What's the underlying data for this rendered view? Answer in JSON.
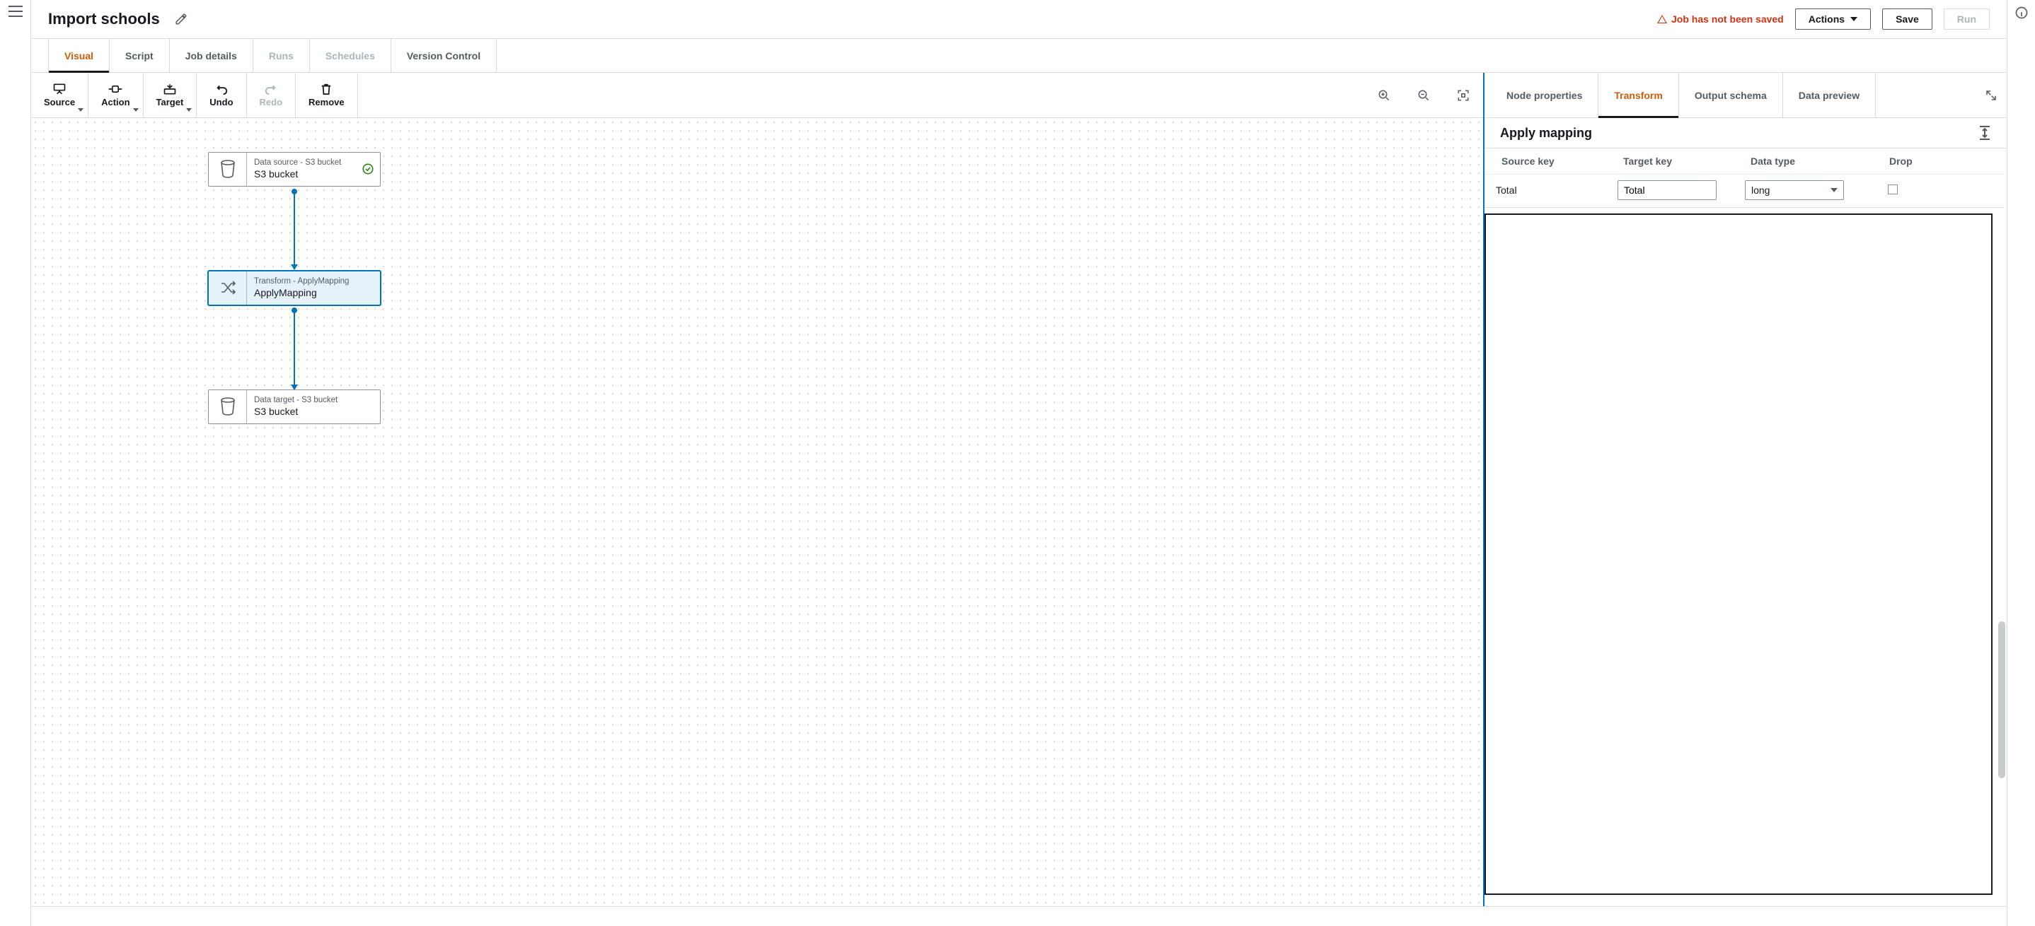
{
  "header": {
    "title": "Import schools",
    "status_text": "Job has not been saved",
    "actions_label": "Actions",
    "save_label": "Save",
    "run_label": "Run"
  },
  "main_tabs": [
    {
      "label": "Visual",
      "active": true,
      "disabled": false
    },
    {
      "label": "Script",
      "active": false,
      "disabled": false
    },
    {
      "label": "Job details",
      "active": false,
      "disabled": false
    },
    {
      "label": "Runs",
      "active": false,
      "disabled": true
    },
    {
      "label": "Schedules",
      "active": false,
      "disabled": true
    },
    {
      "label": "Version Control",
      "active": false,
      "disabled": false
    }
  ],
  "canvas_toolbar": {
    "source": "Source",
    "action": "Action",
    "target": "Target",
    "undo": "Undo",
    "redo": "Redo",
    "remove": "Remove"
  },
  "nodes": {
    "source": {
      "subtitle": "Data source - S3 bucket",
      "title": "S3 bucket"
    },
    "transform": {
      "subtitle": "Transform - ApplyMapping",
      "title": "ApplyMapping"
    },
    "target": {
      "subtitle": "Data target - S3 bucket",
      "title": "S3 bucket"
    }
  },
  "side_tabs": [
    {
      "label": "Node properties",
      "active": false
    },
    {
      "label": "Transform",
      "active": true
    },
    {
      "label": "Output schema",
      "active": false
    },
    {
      "label": "Data preview",
      "active": false
    }
  ],
  "panel": {
    "title": "Apply mapping",
    "columns": {
      "source_key": "Source key",
      "target_key": "Target key",
      "data_type": "Data type",
      "drop": "Drop"
    },
    "rows": [
      {
        "source_key": "Total",
        "target_key": "Total",
        "data_type": "long",
        "drop": false
      }
    ]
  }
}
